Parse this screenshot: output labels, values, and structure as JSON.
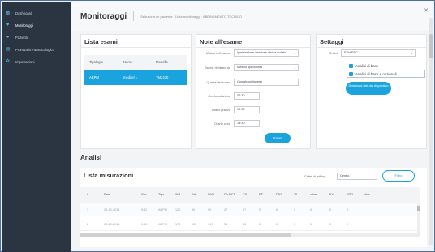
{
  "sidebar": {
    "items": [
      {
        "label": "Dashboard",
        "icon": "grid-icon"
      },
      {
        "label": "Monitoraggi",
        "icon": "heart-icon"
      },
      {
        "label": "Pazienti",
        "icon": "user-icon"
      },
      {
        "label": "Prontuario Farmacologico",
        "icon": "book-icon"
      },
      {
        "label": "Impostazioni",
        "icon": "gear-icon"
      }
    ]
  },
  "header": {
    "title": "Monitoraggi",
    "breadcrumb": "Seleziona un paziente · Lista monitoraggi · ABBINAMENTO TECNICO"
  },
  "lista_esami": {
    "title": "Lista esami",
    "columns": [
      "Tipologia",
      "Nome",
      "Modello"
    ],
    "rows": [
      [
        "ABPM",
        "meditel 1",
        "TM2430"
      ]
    ]
  },
  "note": {
    "title": "Note all'esame",
    "fields": [
      {
        "label": "Motivo dell'esame",
        "value": "Ipertensione arteriosa clinica isolato",
        "select": true
      },
      {
        "label": "Esame richiesto da",
        "value": "Medico specialista",
        "select": true
      },
      {
        "label": "Qualità del sonno",
        "value": "Con alcuni risvegli",
        "select": true
      },
      {
        "label": "Orario colazione",
        "value": "07:30",
        "select": false
      },
      {
        "label": "Orario pranzo",
        "value": "12:30",
        "select": false
      },
      {
        "label": "Orario cena",
        "value": "19:30",
        "select": false
      }
    ],
    "save_label": "Salva"
  },
  "settaggi": {
    "title": "Settaggi",
    "criteri_label": "Criteri",
    "criteri_value": "ESH/ESC",
    "check1": "Analisi di base",
    "check2": "Analisi di base + opzionali",
    "download_label": "Download dati dal dispositivo"
  },
  "analisi": {
    "title": "Analisi",
    "list_title": "Lista misurazioni",
    "editing_label": "Criteri di editing",
    "editing_value": "Centro",
    "filter_label": "Filtro",
    "columns": [
      "#",
      "Data",
      "Ora",
      "Tipo",
      "SIS",
      "DIA",
      "PAM",
      "PA DIFF",
      "FC",
      "DP",
      "PDS",
      "°C",
      "mbar",
      "EV",
      "ERR",
      "Note"
    ],
    "rows": [
      [
        "1",
        "23-10-2014",
        "9:32",
        "ABPM",
        "120",
        "80",
        "90",
        "27",
        "57",
        "0",
        "0",
        "0",
        "0",
        "0",
        "0",
        ""
      ],
      [
        "2",
        "23-10-2014",
        "9:43",
        "ABPM",
        "170",
        "130",
        "147",
        "34",
        "80",
        "0",
        "0",
        "0",
        "0",
        "0",
        "0",
        ""
      ]
    ]
  },
  "colors": {
    "accent": "#1aa3dd",
    "sidebar_bg": "#2b3542"
  }
}
